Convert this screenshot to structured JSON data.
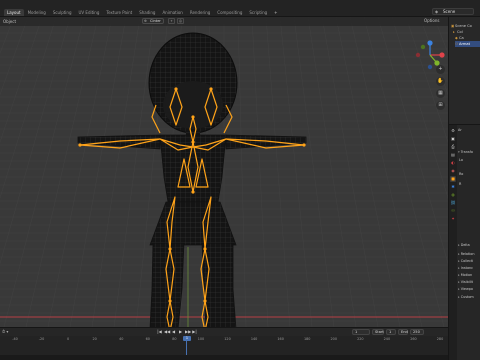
{
  "workspace_tabs": [
    "Layout",
    "Modeling",
    "Sculpting",
    "UV Editing",
    "Texture Paint",
    "Shading",
    "Animation",
    "Rendering",
    "Compositing",
    "Scripting",
    "+"
  ],
  "active_tab": "Layout",
  "scene_name": "Scene",
  "viewport": {
    "header_label": "Object",
    "mode": "Cinter",
    "options_label": "Options",
    "nav_tools": [
      "+",
      "✋",
      "▦",
      "⊞"
    ]
  },
  "outliner": {
    "rows": [
      {
        "label": "Scene Co",
        "selected": false
      },
      {
        "label": "Col",
        "selected": false
      },
      {
        "label": "Ca",
        "selected": false
      },
      {
        "label": "Armat",
        "selected": true
      }
    ]
  },
  "properties": {
    "header_label": "Ar",
    "rows": [
      {
        "label": "Transfo",
        "caret": "▾"
      },
      {
        "label": "Lo",
        "caret": ""
      },
      {
        "label": "Ro",
        "caret": ""
      },
      {
        "label": "R",
        "caret": ""
      },
      {
        "label": "Delta",
        "caret": "▸"
      },
      {
        "label": "Relation",
        "caret": "▸"
      },
      {
        "label": "Collecti",
        "caret": "▸"
      },
      {
        "label": "Instanc",
        "caret": "▸"
      },
      {
        "label": "Motion",
        "caret": "▸"
      },
      {
        "label": "Visibilit",
        "caret": "▸"
      },
      {
        "label": "Viewpo",
        "caret": "▸"
      },
      {
        "label": "Custom",
        "caret": "▸"
      }
    ]
  },
  "timeline": {
    "current_frame": "1",
    "start_label": "Start",
    "start_value": "1",
    "end_label": "End",
    "end_value": "250",
    "playhead_label": "1",
    "ruler_ticks": [
      "-40",
      "-20",
      "0",
      "20",
      "40",
      "60",
      "80",
      "100",
      "120",
      "140",
      "160",
      "180",
      "200",
      "220",
      "240",
      "260",
      "280"
    ],
    "transport": [
      "|◀",
      "◀◀",
      "◀",
      "▶",
      "▶▶",
      "▶|"
    ]
  },
  "colors": {
    "bone_orange": "#ffa319",
    "axis_red": "#e0434a",
    "axis_green": "#7fb62b",
    "axis_blue": "#3b82e0",
    "selection_blue": "#334d80",
    "playhead_blue": "#4772b3"
  }
}
